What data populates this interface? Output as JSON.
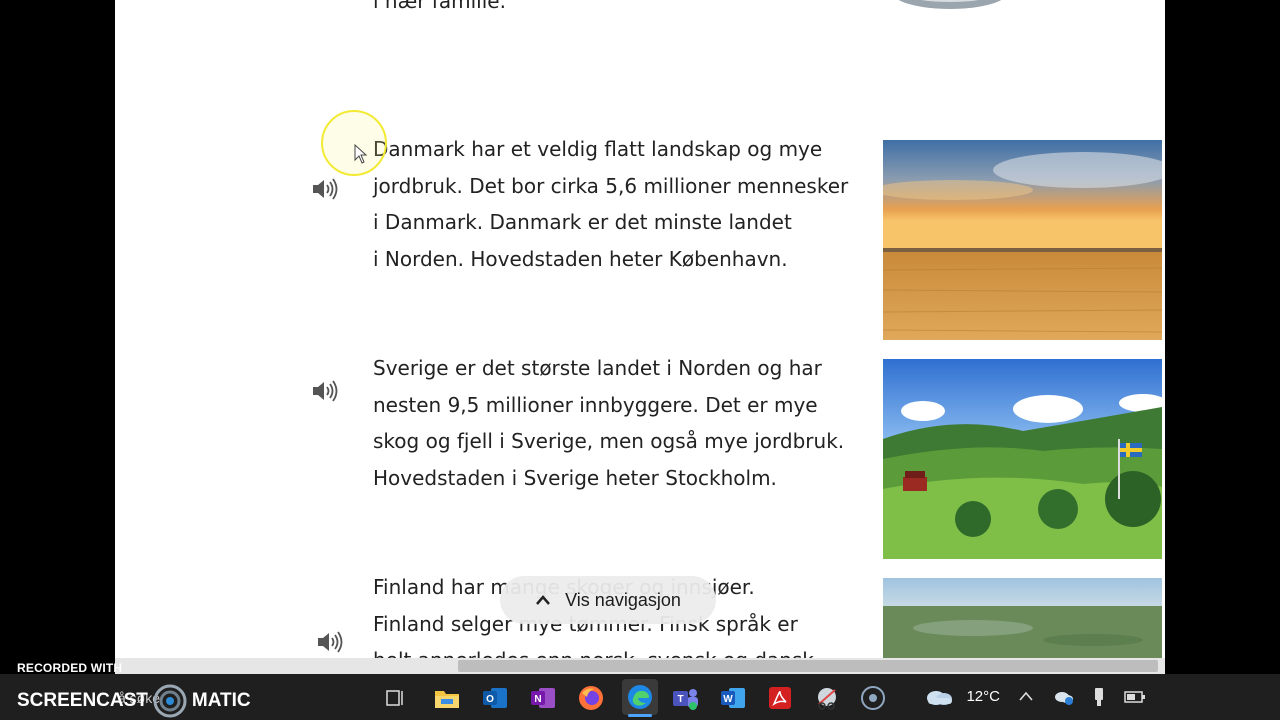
{
  "article": {
    "top_fragment": "i nær familie.",
    "paragraphs": [
      {
        "id": "denmark",
        "lines": [
          "Danmark har et veldig flatt landskap og mye",
          "jordbruk. Det bor cirka 5,6 millioner mennesker",
          "i Danmark. Danmark er det minste landet",
          "i Norden. Hovedstaden heter København."
        ],
        "audio_icon": "speaker-icon",
        "image": "wheat-field-sunset"
      },
      {
        "id": "sweden",
        "lines": [
          "Sverige er det største landet i Norden og har",
          "nesten 9,5 millioner innbyggere. Det er mye",
          "skog og fjell i Sverige, men også mye jordbruk.",
          "Hovedstaden i Sverige heter Stockholm."
        ],
        "audio_icon": "speaker-icon",
        "image": "swedish-countryside-flag"
      },
      {
        "id": "finland",
        "lines": [
          "Finland har mange skoger og innsjøer.",
          "Finland selger mye tømmer. Finsk språk er",
          "helt annerledes enn norsk, svensk og dansk."
        ],
        "audio_icon": "speaker-icon",
        "image": "finnish-forest-aerial"
      }
    ]
  },
  "navigation": {
    "show_nav_label": "Vis navigasjon",
    "icon": "chevron-up-icon"
  },
  "taskbar": {
    "search_fragment": "å søke",
    "apps": [
      "task-view-icon",
      "file-explorer-icon",
      "outlook-icon",
      "onenote-icon",
      "firefox-icon",
      "edge-icon",
      "teams-icon",
      "word-icon",
      "acrobat-icon",
      "snipping-tool-icon",
      "recorder-icon"
    ],
    "weather": {
      "temperature": "12°C",
      "icon": "cloud-icon"
    },
    "tray_icons": [
      "chevron-up-icon",
      "onedrive-icon",
      "usb-icon",
      "battery-icon"
    ]
  },
  "watermark": {
    "recorded_with": "RECORDED WITH",
    "brand_left": "SCREENCAST",
    "brand_right": "MATIC"
  },
  "colors": {
    "page_background": "#ffffff",
    "text": "#222222",
    "cursor_highlight": "#f3ea33",
    "taskbar": "#1f1f1f",
    "edge_active": "#1e88e5"
  }
}
